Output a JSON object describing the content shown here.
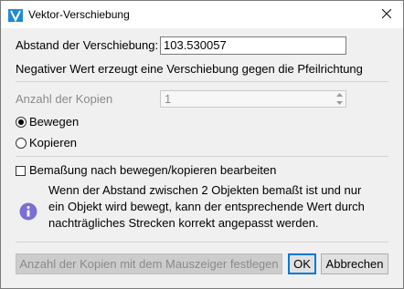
{
  "window": {
    "title": "Vektor-Verschiebung",
    "app_icon": "blue-v-icon",
    "close_icon": "close-icon"
  },
  "distance": {
    "label": "Abstand der Verschiebung:",
    "value": "103.530057",
    "hint": "Negativer Wert erzeugt eine Verschiebung gegen die Pfeilrichtung"
  },
  "copies": {
    "label": "Anzahl der Kopien",
    "value": "1"
  },
  "mode": {
    "options": [
      {
        "label": "Bewegen",
        "selected": true
      },
      {
        "label": "Kopieren",
        "selected": false
      }
    ]
  },
  "edit_dimension": {
    "label": "Bemaßung nach bewegen/kopieren bearbeiten",
    "checked": false
  },
  "info": {
    "icon": "info-icon",
    "text": "Wenn der Abstand zwischen 2 Objekten bemaßt ist und nur ein Objekt wird bewegt, kann der entsprechende Wert durch nachträgliches Strecken korrekt angepasst werden."
  },
  "buttons": {
    "set_copies_mouse": "Anzahl der Kopien mit dem Mauszeiger festlegen",
    "ok": "OK",
    "cancel": "Abbrechen"
  },
  "colors": {
    "accent": "#0078d7",
    "info_icon": "#7b6fd6",
    "app_icon": "#1e8ad6"
  }
}
